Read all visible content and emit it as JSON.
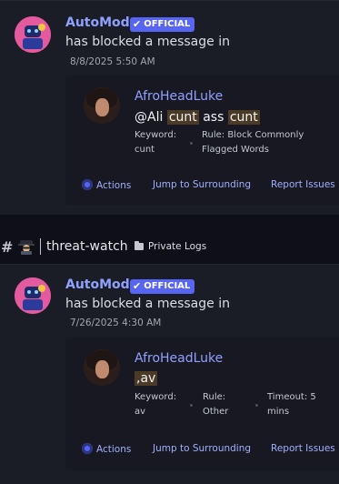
{
  "cards": [
    {
      "bot_name": "AutoMod",
      "badge": "OFFICIAL",
      "action_text": "has blocked a message in",
      "timestamp": "8/8/2025 5:50 AM",
      "user_name": "AfroHeadLuke",
      "message": {
        "mention": "@Ali",
        "w1": "cunt",
        "w2": "ass",
        "w3": "cunt"
      },
      "keyword_label": "Keyword:",
      "keyword_value": "cunt",
      "rule_label": "Rule: Block Commonly",
      "rule_value": "Flagged Words",
      "actions": [
        "Actions",
        "Jump to Surrounding",
        "Report Issues"
      ]
    },
    {
      "bot_name": "AutoMod",
      "badge": "OFFICIAL",
      "action_text": "has blocked a message in",
      "timestamp": "7/26/2025 4:30 AM",
      "user_name": "AfroHeadLuke",
      "message_text": ",av",
      "keyword_label": "Keyword:",
      "keyword_value": "av",
      "rule_label": "Rule:",
      "rule_value": "Other",
      "timeout_label": "Timeout: 5",
      "timeout_value": "mins",
      "actions": [
        "Actions",
        "Jump to Surrounding",
        "Report Issues"
      ]
    }
  ],
  "channel_bar": {
    "hash": "#",
    "channel_name": "threat-watch",
    "category": "Private Logs"
  },
  "colors": {
    "accent": "#5865f2",
    "name": "#8fa1ff",
    "highlight": "#4a3a26"
  }
}
